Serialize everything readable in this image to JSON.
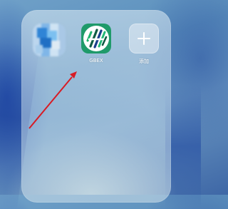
{
  "folder": {
    "apps": [
      {
        "label": "",
        "icon": "blurred-app-icon"
      },
      {
        "label": "GBEX",
        "icon": "gbex-app-icon",
        "accent": "#1f9a6a"
      },
      {
        "label": "添加",
        "icon": "plus-icon"
      }
    ]
  },
  "annotation": {
    "color": "#d81b24",
    "icon": "red-arrow-icon"
  }
}
